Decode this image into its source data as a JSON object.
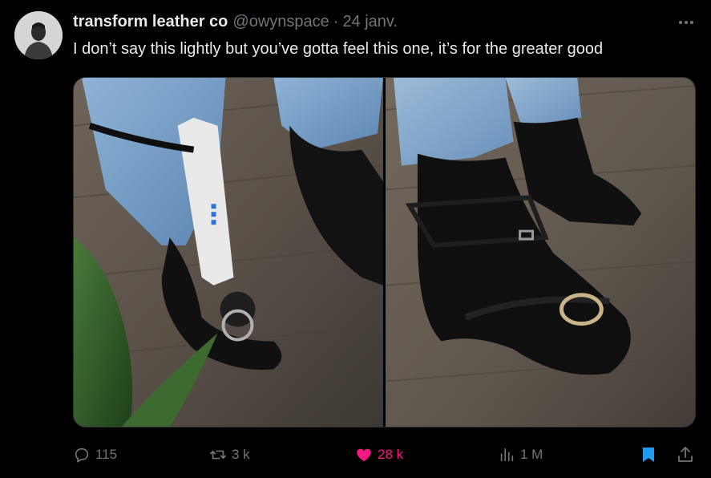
{
  "author": {
    "display_name": "transform leather co",
    "handle": "@owynspace",
    "separator": "·",
    "date": "24 janv."
  },
  "tweet": {
    "text": "I don’t say this lightly but you’ve gotta feel this one, it’s for the greater good"
  },
  "media": {
    "photos": [
      {
        "subject": "leather-harness-boot-with-wand"
      },
      {
        "subject": "leather-harness-boot-with-ring"
      }
    ]
  },
  "actions": {
    "replies": "115",
    "reposts": "3 k",
    "likes": "28 k",
    "views": "1 M"
  },
  "icons": {
    "reply": "reply-icon",
    "repost": "repost-icon",
    "like": "heart-icon",
    "views": "views-icon",
    "bookmark": "bookmark-icon",
    "share": "share-icon",
    "more": "more-icon"
  },
  "colors": {
    "background": "#000000",
    "text": "#e7e9ea",
    "muted": "#71767b",
    "like": "#f91880",
    "bookmark": "#1d9bf0"
  }
}
